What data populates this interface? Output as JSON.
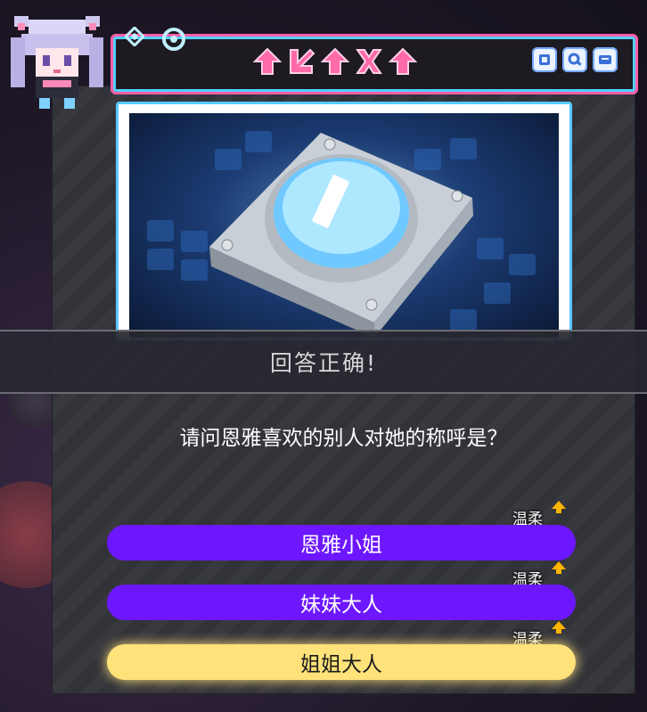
{
  "header": {
    "logo_text": "",
    "hud_icons": [
      "skip-icon",
      "search-icon",
      "menu-icon"
    ]
  },
  "card": {
    "image_subject": "glowing-blue-button-icon"
  },
  "result_banner": "回答正确!",
  "question": "请问恩雅喜欢的别人对她的称呼是？",
  "answers": [
    {
      "label": "恩雅小姐",
      "tag": "温柔",
      "style": "purple"
    },
    {
      "label": "妹妹大人",
      "tag": "温柔",
      "style": "purple"
    },
    {
      "label": "姐姐大人",
      "tag": "温柔",
      "style": "yellow"
    }
  ],
  "colors": {
    "accent_pink": "#ff5fa8",
    "accent_cyan": "#4fd0ff",
    "answer_purple": "#6c17ff",
    "answer_selected": "#ffe27a",
    "tag_arrow": "#ffb400"
  }
}
